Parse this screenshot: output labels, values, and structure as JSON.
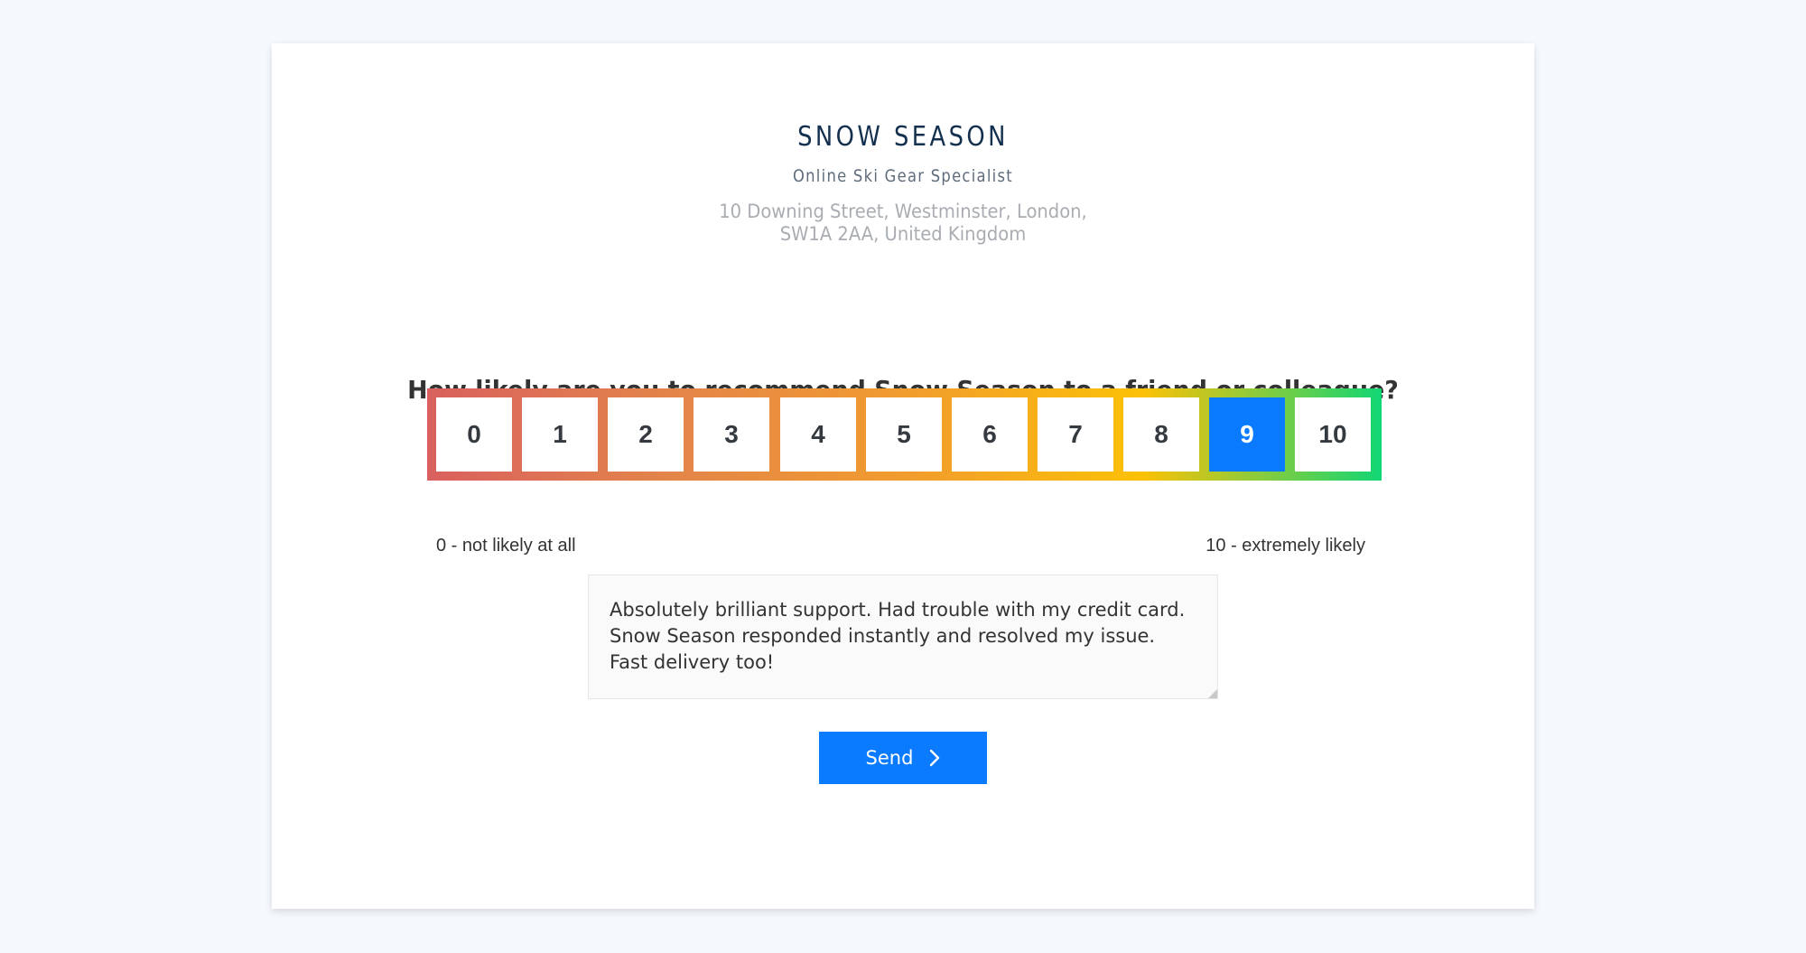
{
  "company": {
    "name": "SNOW SEASON",
    "tagline": "Online Ski Gear Specialist",
    "address_line1": "10 Downing Street, Westminster, London,",
    "address_line2": "SW1A 2AA, United Kingdom"
  },
  "survey": {
    "question": "How likely are you to recommend Snow Season to a friend or colleague?",
    "scores": [
      "0",
      "1",
      "2",
      "3",
      "4",
      "5",
      "6",
      "7",
      "8",
      "9",
      "10"
    ],
    "selected_score": "9",
    "low_label": "0 - not likely at all",
    "high_label": "10 - extremely likely",
    "comment": "Absolutely brilliant support. Had trouble with my credit card. Snow Season responded instantly and resolved my issue. Fast delivery too!",
    "send_label": "Send",
    "send_icon": "chevron-right-icon"
  },
  "colors": {
    "page_background": "#f5f9fd",
    "accent": "#0a7bff",
    "brand": "#14304f",
    "scale_gradient": [
      "#d9605e",
      "#e3844a",
      "#f19c2e",
      "#fcc106",
      "#12d674"
    ]
  }
}
